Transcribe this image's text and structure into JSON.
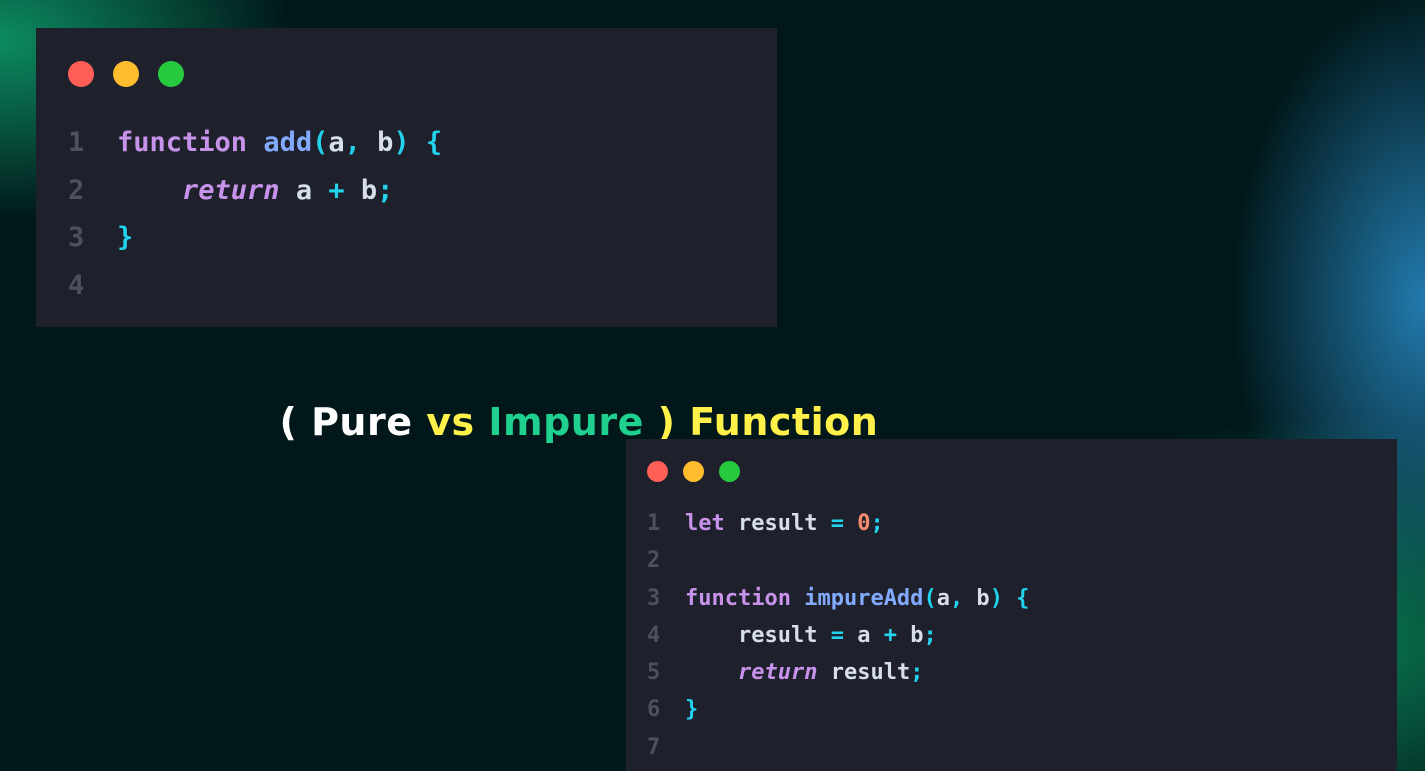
{
  "colors": {
    "dot_red": "#ff5f56",
    "dot_yellow": "#ffbd2e",
    "dot_green": "#27c93f",
    "title_white": "#ffffff",
    "title_yellow": "#fff04a",
    "title_green": "#1fd08e"
  },
  "title": {
    "paren_open": "( ",
    "pure": "Pure",
    "vs": " vs ",
    "impure": "Impure",
    "paren_close": " ) ",
    "function": "Function"
  },
  "windows": [
    {
      "lines": [
        {
          "num": "1",
          "tokens": [
            {
              "t": "function",
              "c": "kw"
            },
            {
              "t": " ",
              "c": "id"
            },
            {
              "t": "add",
              "c": "fn"
            },
            {
              "t": "(",
              "c": "punc"
            },
            {
              "t": "a",
              "c": "id"
            },
            {
              "t": ",",
              "c": "punc"
            },
            {
              "t": " b",
              "c": "id"
            },
            {
              "t": ")",
              "c": "punc"
            },
            {
              "t": " {",
              "c": "punc"
            }
          ]
        },
        {
          "num": "2",
          "tokens": [
            {
              "t": "    ",
              "c": "id"
            },
            {
              "t": "return",
              "c": "ret"
            },
            {
              "t": " a ",
              "c": "id"
            },
            {
              "t": "+",
              "c": "punc"
            },
            {
              "t": " b",
              "c": "id"
            },
            {
              "t": ";",
              "c": "punc"
            }
          ]
        },
        {
          "num": "3",
          "tokens": [
            {
              "t": "}",
              "c": "punc"
            }
          ]
        },
        {
          "num": "4",
          "tokens": []
        }
      ]
    },
    {
      "lines": [
        {
          "num": "1",
          "tokens": [
            {
              "t": "let",
              "c": "kw"
            },
            {
              "t": " result ",
              "c": "id"
            },
            {
              "t": "=",
              "c": "punc"
            },
            {
              "t": " ",
              "c": "id"
            },
            {
              "t": "0",
              "c": "num"
            },
            {
              "t": ";",
              "c": "punc"
            }
          ]
        },
        {
          "num": "2",
          "tokens": []
        },
        {
          "num": "3",
          "tokens": [
            {
              "t": "function",
              "c": "kw"
            },
            {
              "t": " ",
              "c": "id"
            },
            {
              "t": "impureAdd",
              "c": "fn"
            },
            {
              "t": "(",
              "c": "punc"
            },
            {
              "t": "a",
              "c": "id"
            },
            {
              "t": ",",
              "c": "punc"
            },
            {
              "t": " b",
              "c": "id"
            },
            {
              "t": ")",
              "c": "punc"
            },
            {
              "t": " {",
              "c": "punc"
            }
          ]
        },
        {
          "num": "4",
          "tokens": [
            {
              "t": "    result ",
              "c": "id"
            },
            {
              "t": "=",
              "c": "punc"
            },
            {
              "t": " a ",
              "c": "id"
            },
            {
              "t": "+",
              "c": "punc"
            },
            {
              "t": " b",
              "c": "id"
            },
            {
              "t": ";",
              "c": "punc"
            }
          ]
        },
        {
          "num": "5",
          "tokens": [
            {
              "t": "    ",
              "c": "id"
            },
            {
              "t": "return",
              "c": "ret"
            },
            {
              "t": " result",
              "c": "id"
            },
            {
              "t": ";",
              "c": "punc"
            }
          ]
        },
        {
          "num": "6",
          "tokens": [
            {
              "t": "}",
              "c": "punc"
            }
          ]
        },
        {
          "num": "7",
          "tokens": []
        }
      ]
    }
  ]
}
